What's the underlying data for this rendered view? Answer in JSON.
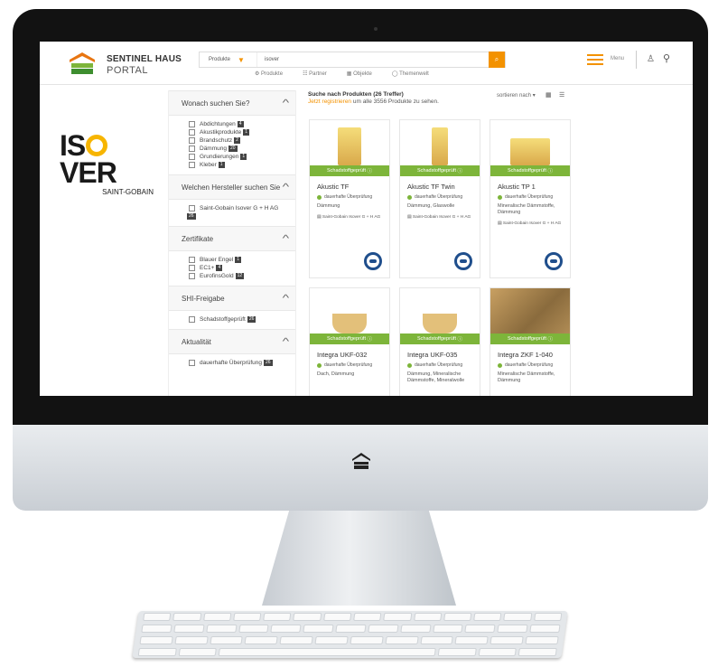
{
  "header": {
    "brand_line1": "SENTINEL HAUS",
    "brand_line2": "PORTAL",
    "search": {
      "category": "Produkte",
      "query": "isover",
      "button_icon": "search-icon"
    },
    "subnav": [
      "Produkte",
      "Partner",
      "Objekte",
      "Themenwelt"
    ],
    "menu_label": "Menu",
    "accent": "#f39200"
  },
  "sponsor": {
    "name": "ISOVER",
    "sub": "SAINT-GOBAIN"
  },
  "filters": [
    {
      "title": "Wonach suchen Sie?",
      "items": [
        {
          "label": "Abdichtungen",
          "count": "4"
        },
        {
          "label": "Akustikprodukte",
          "count": "1"
        },
        {
          "label": "Brandschutz",
          "count": "2"
        },
        {
          "label": "Dämmung",
          "count": "20"
        },
        {
          "label": "Grundierungen",
          "count": "1"
        },
        {
          "label": "Kleber",
          "count": "1"
        }
      ]
    },
    {
      "title": "Welchen Hersteller suchen Sie",
      "items": [
        {
          "label": "Saint-Gobain Isover G + H AG",
          "count": "26"
        }
      ]
    },
    {
      "title": "Zertifikate",
      "items": [
        {
          "label": "Blauer Engel",
          "count": "1"
        },
        {
          "label": "EC1+",
          "count": "4"
        },
        {
          "label": "EurofinsGold",
          "count": "12"
        }
      ]
    },
    {
      "title": "SHI-Freigabe",
      "items": [
        {
          "label": "Schadstoffgeprüft",
          "count": "26"
        }
      ]
    },
    {
      "title": "Aktualität",
      "items": [
        {
          "label": "dauerhafte Überprüfung",
          "count": "26"
        }
      ]
    }
  ],
  "results": {
    "heading": "Suche nach Produkten (26 Treffer)",
    "register_link": "Jetzt registrieren",
    "register_rest": "um alle 3556 Produkte zu sehen.",
    "sort_label": "sortieren nach",
    "ribbon": "Schadstoffgeprüft",
    "status": "dauerhafte Überprüfung",
    "cards": [
      {
        "title": "Akustic TF",
        "category": "Dämmung",
        "maker": "Saint-Gobain Isover G + H AG"
      },
      {
        "title": "Akustic TF Twin",
        "category": "Dämmung, Glaswolle",
        "maker": "Saint-Gobain Isover G + H AG"
      },
      {
        "title": "Akustic TP 1",
        "category": "Mineralische Dämmstoffe, Dämmung",
        "maker": "Saint-Gobain Isover G + H AG"
      },
      {
        "title": "Integra UKF-032",
        "category": "Dach, Dämmung",
        "maker": ""
      },
      {
        "title": "Integra UKF-035",
        "category": "Dämmung, Mineralische Dämmstoffe, Mineralwolle",
        "maker": ""
      },
      {
        "title": "Integra ZKF 1-040",
        "category": "Mineralische Dämmstoffe, Dämmung",
        "maker": ""
      }
    ]
  }
}
